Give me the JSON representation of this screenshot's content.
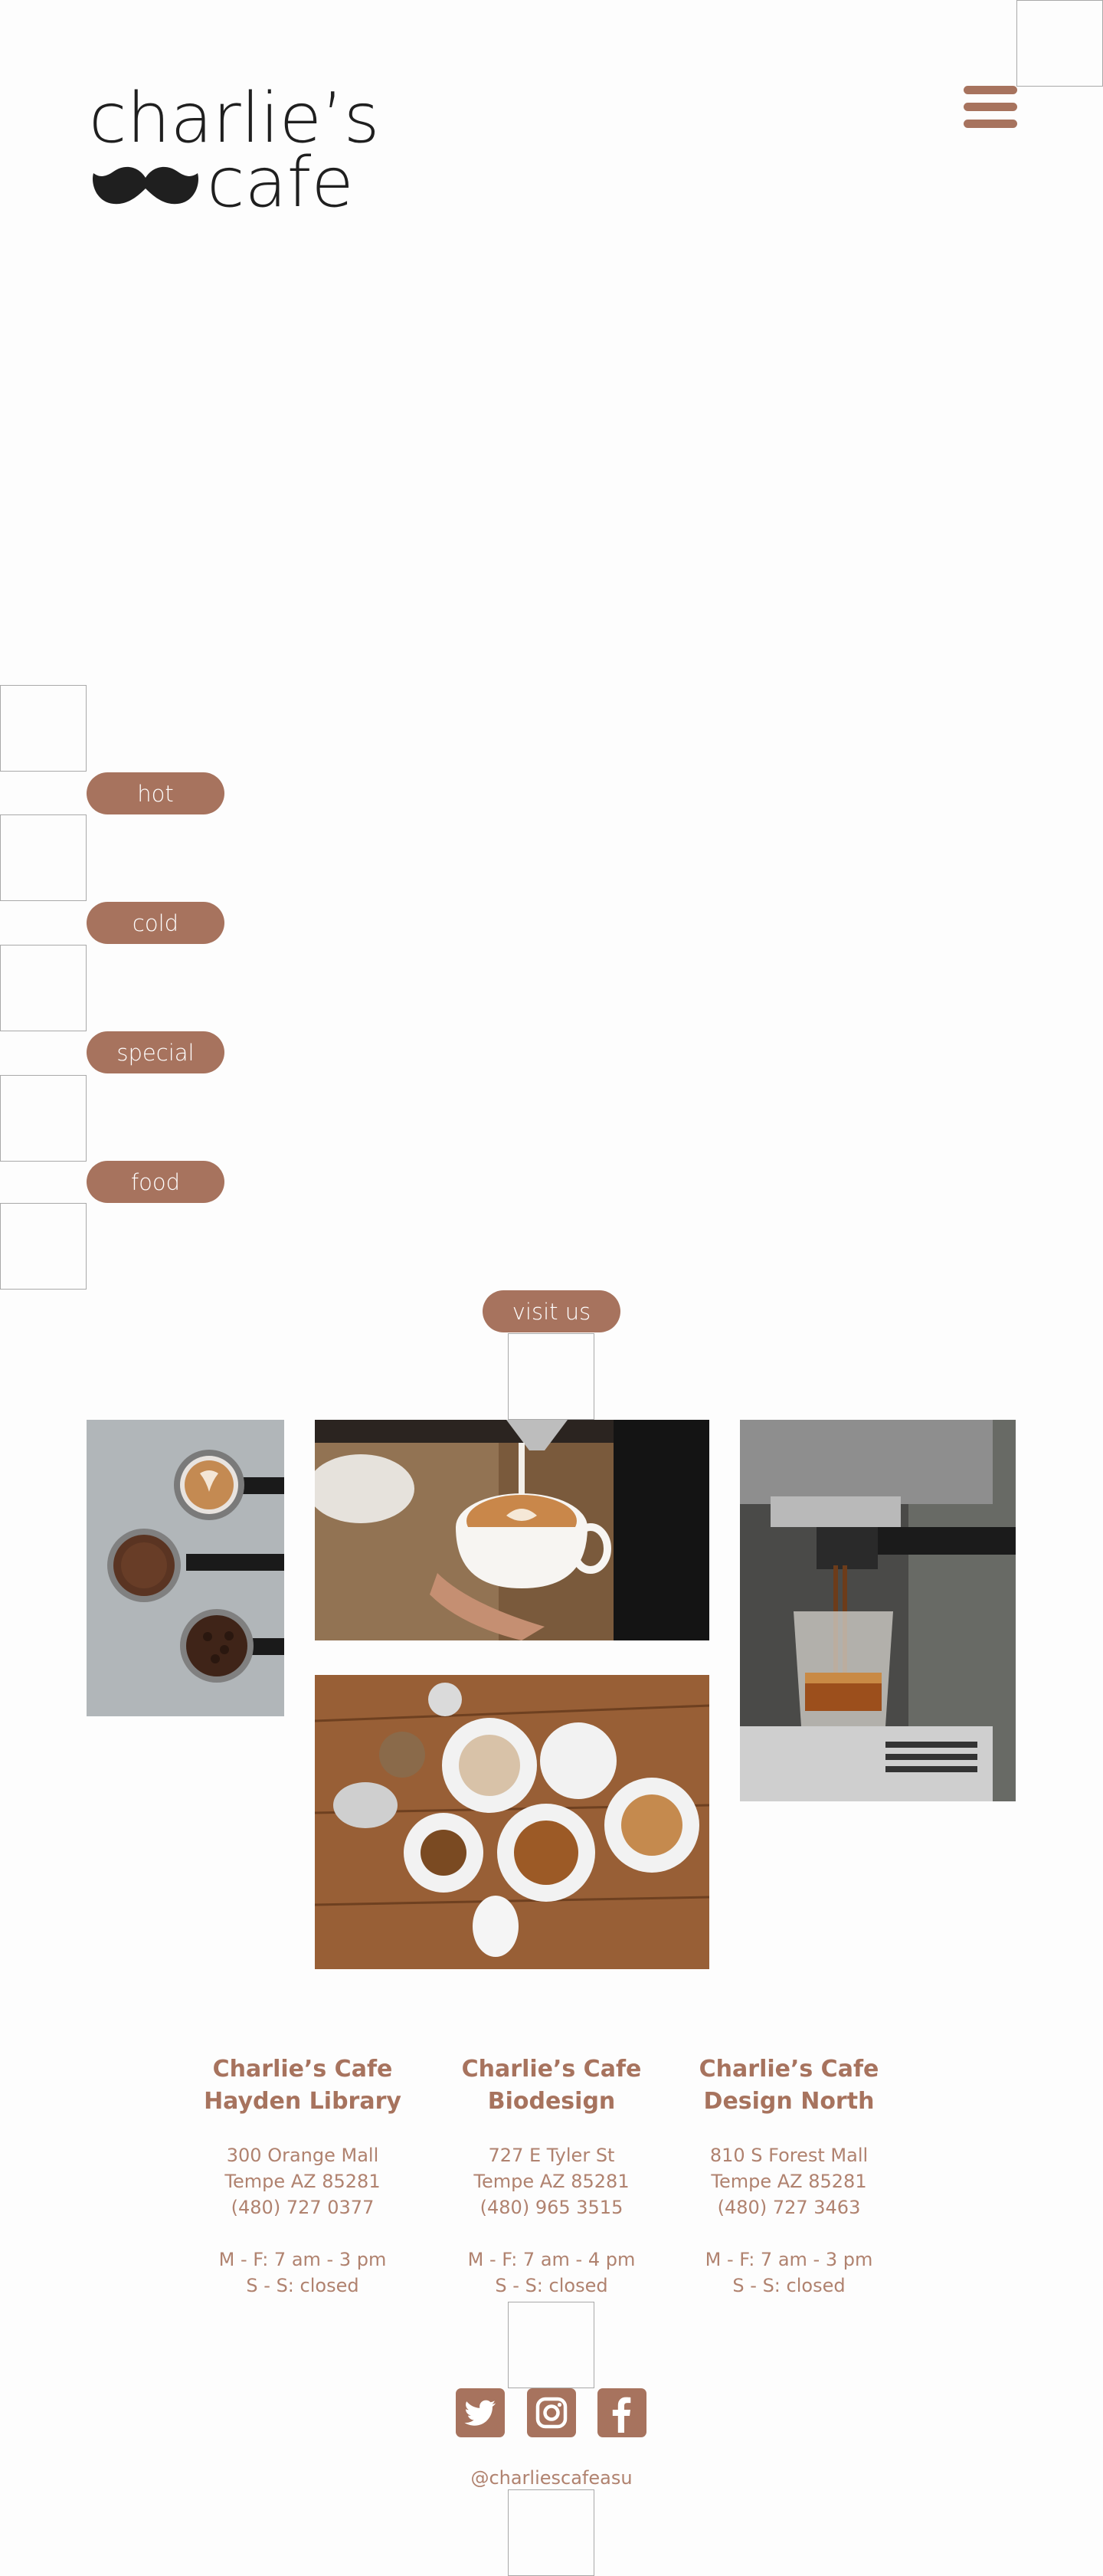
{
  "logo": {
    "line1": "charlie’s",
    "line2": "cafe"
  },
  "menu_buttons": [
    {
      "label": "hot"
    },
    {
      "label": "cold"
    },
    {
      "label": "special"
    },
    {
      "label": "food"
    }
  ],
  "visit_label": "visit us",
  "locations": [
    {
      "name_line1": "Charlie’s Cafe",
      "name_line2": "Hayden Library",
      "street": "300 Orange Mall",
      "city": "Tempe AZ 85281",
      "phone": "(480) 727 0377",
      "weekday_hours": "M - F: 7 am - 3 pm",
      "weekend_hours": "S - S: closed"
    },
    {
      "name_line1": "Charlie’s Cafe",
      "name_line2": "Biodesign",
      "street": "727 E Tyler St",
      "city": "Tempe AZ 85281",
      "phone": "(480) 965 3515",
      "weekday_hours": "M - F: 7 am - 4 pm",
      "weekend_hours": "S - S: closed"
    },
    {
      "name_line1": "Charlie’s Cafe",
      "name_line2": "Design North",
      "street": "810 S Forest Mall",
      "city": "Tempe AZ 85281",
      "phone": "(480) 727 3463",
      "weekday_hours": "M - F: 7 am - 3 pm",
      "weekend_hours": "S - S: closed"
    }
  ],
  "social": {
    "handle": "@charliescafeasu",
    "icons": [
      "twitter-icon",
      "instagram-icon",
      "facebook-icon"
    ]
  },
  "colors": {
    "accent": "#a7735e",
    "logo": "#1f1f1f",
    "frame": "#a9a9a9"
  }
}
